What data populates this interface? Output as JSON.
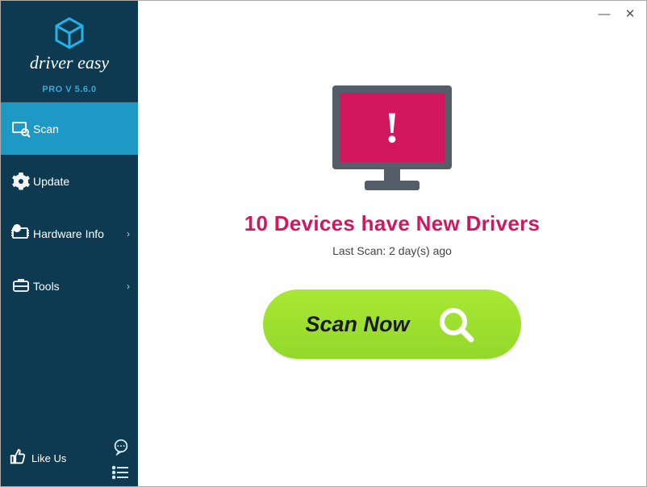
{
  "sidebar": {
    "version": "PRO V 5.6.0",
    "items": [
      {
        "label": "Scan",
        "icon": "scan-icon",
        "active": true,
        "chevron": false
      },
      {
        "label": "Update",
        "icon": "gear-icon",
        "active": false,
        "chevron": false
      },
      {
        "label": "Hardware Info",
        "icon": "hardware-info-icon",
        "active": false,
        "chevron": true
      },
      {
        "label": "Tools",
        "icon": "tools-icon",
        "active": false,
        "chevron": true
      }
    ],
    "like_label": "Like Us"
  },
  "main": {
    "headline": "10 Devices have New Drivers",
    "subline": "Last Scan: 2 day(s) ago",
    "scan_button_label": "Scan Now",
    "monitor_glyph": "!"
  },
  "window": {
    "minimize": "—",
    "close": "✕"
  }
}
